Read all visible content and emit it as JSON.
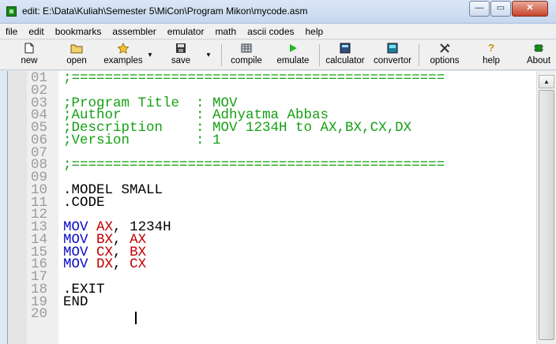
{
  "window": {
    "title": "edit: E:\\Data\\Kuliah\\Semester 5\\MiCon\\Program Mikon\\mycode.asm",
    "minimize_glyph": "—",
    "maximize_glyph": "▭",
    "close_glyph": "✕"
  },
  "menu": [
    "file",
    "edit",
    "bookmarks",
    "assembler",
    "emulator",
    "math",
    "ascii codes",
    "help"
  ],
  "toolbar": {
    "new": "new",
    "open": "open",
    "examples": "examples",
    "save": "save",
    "compile": "compile",
    "emulate": "emulate",
    "calculator": "calculator",
    "convertor": "convertor",
    "options": "options",
    "help": "help",
    "about": "About"
  },
  "icons": {
    "new": "document-icon",
    "open": "folder-icon",
    "examples": "star-icon",
    "save": "floppy-icon",
    "compile": "grid-icon",
    "emulate": "play-icon",
    "calculator": "calculator-icon",
    "convertor": "convertor-icon",
    "options": "tools-icon",
    "help": "question-icon",
    "about": "chip-icon"
  },
  "colors": {
    "comment": "#15a015",
    "keyword": "#0a0ac8",
    "register": "#c00000",
    "line_number": "#9b9b9b"
  },
  "editor": {
    "line_numbers": [
      "01",
      "02",
      "03",
      "04",
      "05",
      "06",
      "07",
      "08",
      "09",
      "10",
      "11",
      "12",
      "13",
      "14",
      "15",
      "16",
      "17",
      "18",
      "19",
      "20"
    ],
    "lines": [
      ";=============================================",
      "",
      ";Program Title  : MOV",
      ";Author         : Adhyatma Abbas",
      ";Description    : MOV 1234H to AX,BX,CX,DX",
      ";Version        : 1",
      "",
      ";=============================================",
      "",
      ".MODEL SMALL",
      ".CODE",
      "",
      "MOV AX, 1234H",
      "MOV BX, AX",
      "MOV CX, BX",
      "MOV DX, CX",
      "",
      ".EXIT",
      "END",
      ""
    ]
  },
  "scrollbar": {
    "up_glyph": "▲"
  }
}
